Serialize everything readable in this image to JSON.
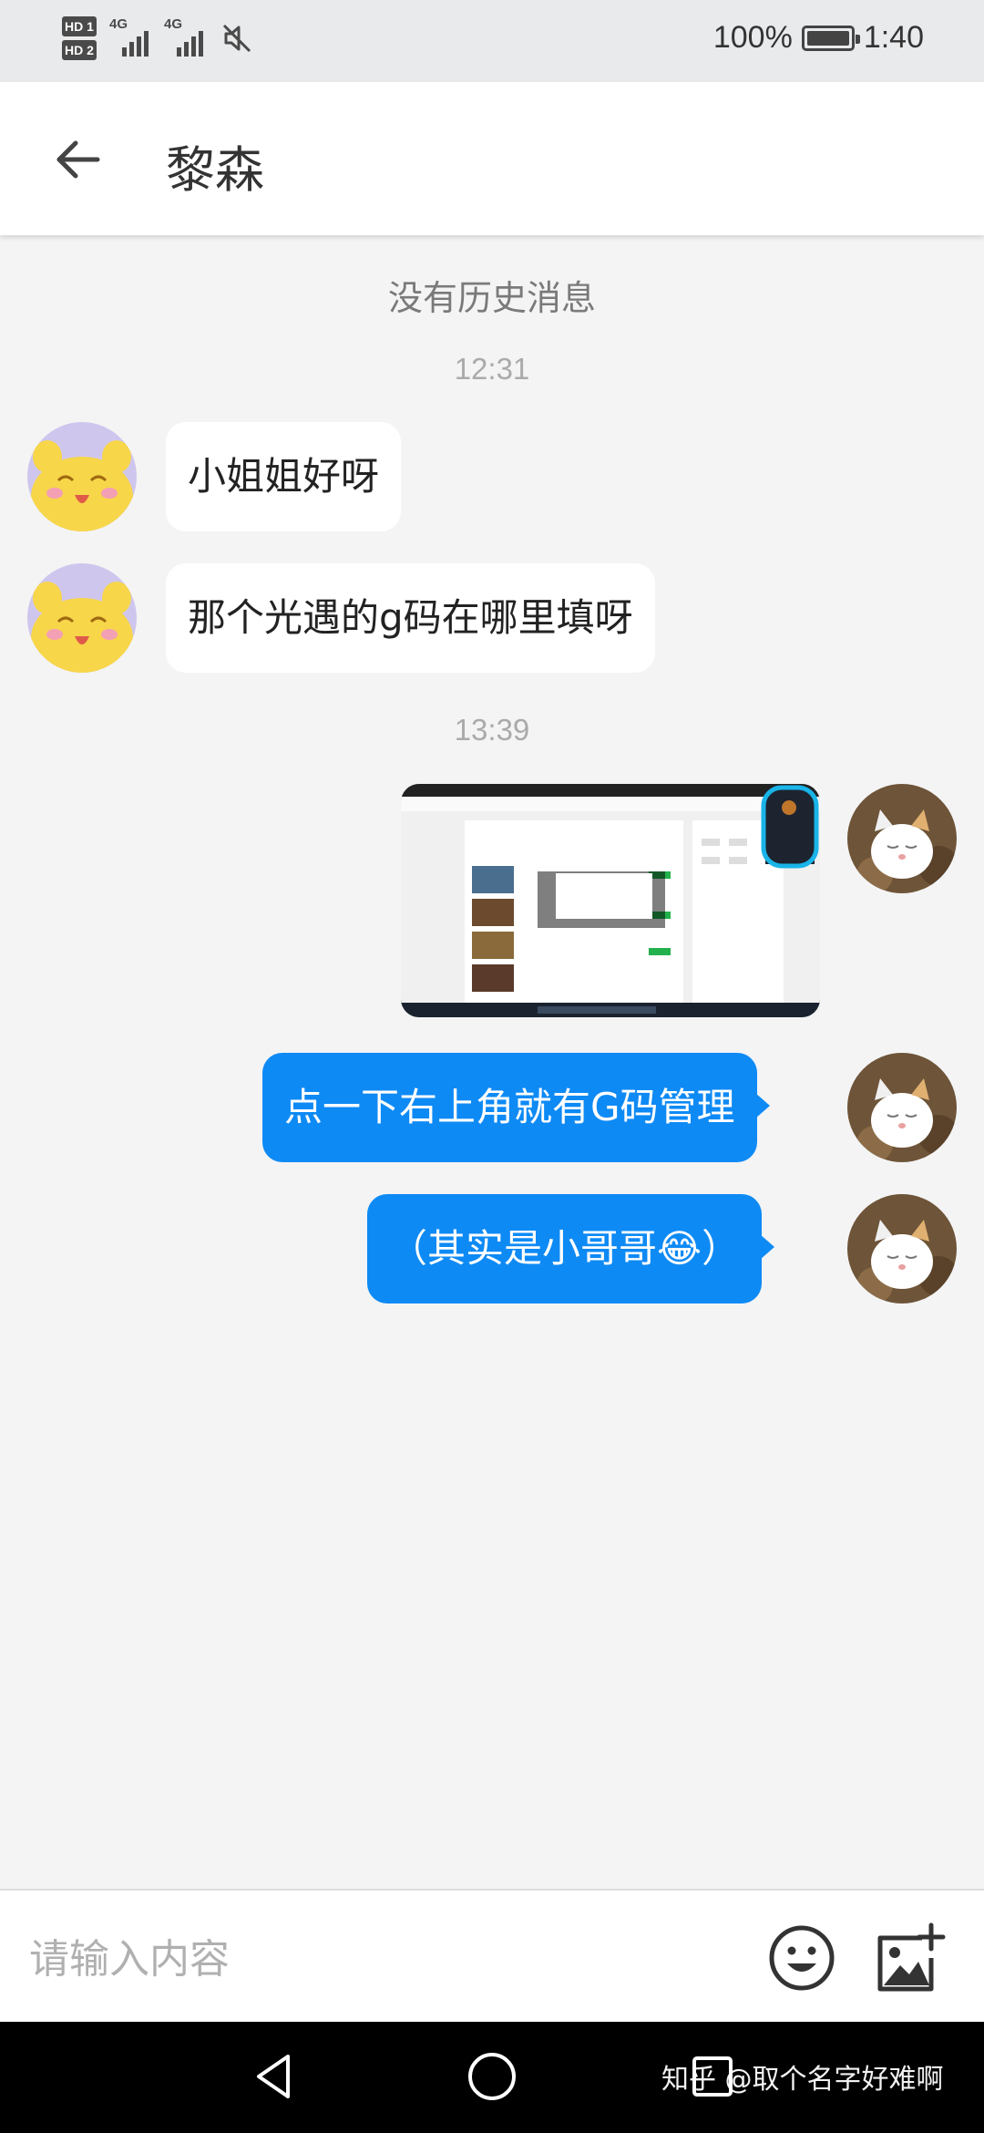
{
  "status_bar": {
    "hd1": "HD 1",
    "hd2": "HD 2",
    "signal1": "4G",
    "signal2": "4G",
    "battery": "100%",
    "time": "1:40",
    "battery_level": 1.0
  },
  "header": {
    "title": "黎森",
    "back_icon": "arrow-left-icon"
  },
  "chat": {
    "no_history": "没有历史消息",
    "messages": [
      {
        "type": "timestamp",
        "text": "12:31"
      },
      {
        "type": "incoming",
        "text": "小姐姐好呀"
      },
      {
        "type": "incoming",
        "text": "那个光遇的g码在哪里填呀"
      },
      {
        "type": "timestamp",
        "text": "13:39"
      },
      {
        "type": "outgoing-image"
      },
      {
        "type": "outgoing",
        "text": "点一下右上角就有G码管理"
      },
      {
        "type": "outgoing",
        "text": "（其实是小哥哥😂）"
      }
    ]
  },
  "input": {
    "placeholder": "请输入内容",
    "emoji_icon": "smiley-icon",
    "image_icon": "image-add-icon"
  },
  "nav": {
    "back_icon": "triangle-back-icon",
    "home_icon": "circle-home-icon",
    "recent_icon": "square-recent-icon"
  },
  "watermark": "知乎 @取个名字好难啊",
  "colors": {
    "accent": "#0e8af5",
    "background": "#f4f4f5",
    "incoming_bubble": "#ffffff"
  }
}
